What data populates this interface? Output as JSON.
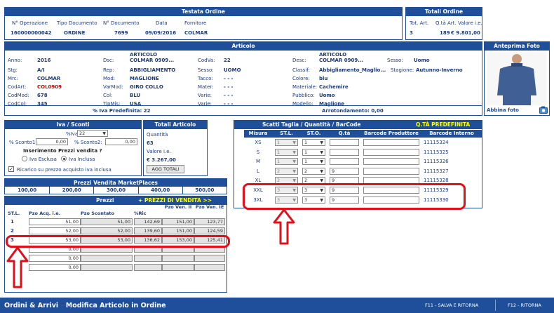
{
  "testata": {
    "title": "Testata Ordine",
    "labels": [
      "N° Operazione",
      "Tipo Documento",
      "N° Documento",
      "Data",
      "Fornitore"
    ],
    "values": [
      "160000000042",
      "ORDINE",
      "7699",
      "09/09/2016",
      "COLMAR"
    ]
  },
  "totali": {
    "title": "Totali Ordine",
    "labels": [
      "Tot. Art.",
      "Q.tà Art.",
      "Valore i.e."
    ],
    "values": [
      "3",
      "189",
      "€ 9.801,00"
    ]
  },
  "articolo": {
    "title": "Articolo",
    "col1": [
      [
        "Anno:",
        "2016"
      ],
      [
        "Stg:",
        "A/I"
      ],
      [
        "Mrc:",
        "COLMAR"
      ],
      [
        "CodArt:",
        "COL0909"
      ],
      [
        "CodMod:",
        "678"
      ],
      [
        "CodCol:",
        "345"
      ]
    ],
    "col2": [
      [
        "Dsc:",
        "ARTICOLO COLMAR 0909..."
      ],
      [
        "Rep:",
        "ABBIGLIAMENTO"
      ],
      [
        "Mod:",
        "MAGLIONE"
      ],
      [
        "VarMod:",
        "GIRO COLLO"
      ],
      [
        "Col:",
        "BLU"
      ],
      [
        "TipMis:",
        "USA"
      ]
    ],
    "col3": [
      [
        "CodVa:",
        "22"
      ],
      [
        "Sesso:",
        "UOMO"
      ],
      [
        "Tacco:",
        "- - -"
      ],
      [
        "Mater:",
        "- - -"
      ],
      [
        "Varie:",
        "- - -"
      ],
      [
        "Varie:",
        "- - -"
      ]
    ],
    "col4": [
      [
        "Desc:",
        "ARTICOLO COLMAR 0909..."
      ],
      [
        "Classif:",
        "Abbigliamento_Maglio..."
      ],
      [
        "Colore:",
        "blu"
      ],
      [
        "Materiale:",
        "Cachemire"
      ],
      [
        "Pubblico:",
        "Uomo"
      ],
      [
        "Modello:",
        "Maglione"
      ]
    ],
    "sesso_label": "Sesso:",
    "sesso_value": "Uomo",
    "stagione_label": "Stagione:",
    "stagione_value": "Autunno-Inverno",
    "iva_predefinita": "% Iva Predefinita: 22",
    "arrotondamento": "Arrotondamento: 0,00"
  },
  "anteprima": {
    "title": "Anteprima Foto",
    "abbina": "Abbina foto"
  },
  "iva": {
    "title": "Iva / Sconti",
    "iva_label": "%Iva:",
    "iva_value": "22",
    "sconto1_label": "% Sconto1:",
    "sconto1_value": "0,00",
    "sconto2_label": "% Sconto2:",
    "sconto2_value": "0,00",
    "inserimento": "Inserimento Prezzi vendita ?",
    "esclusa": "Iva Esclusa",
    "inclusa": "Iva Inclusa",
    "ricarico": "Ricarico su prezzo acquisto iva inclusa"
  },
  "totali_articolo": {
    "title": "Totali Articolo",
    "quantita_label": "Quantità",
    "quantita_value": "63",
    "valore_label": "Valore i.e.",
    "valore_value": "€ 3.267,00",
    "button": "AGG TOTALI"
  },
  "marketplaces": {
    "title": "Prezzi Vendita MarketPlaces",
    "values": [
      "100,00",
      "200,00",
      "300,00",
      "400,00",
      "500,00"
    ]
  },
  "prezzi": {
    "title": "Prezzi",
    "link": "+ PREZZI DI VENDITA >>",
    "headers": [
      "ST.L.",
      "Pzo Acq. i.e.",
      "Pzo Scontato",
      "%Ric",
      "Pzo Ven. II",
      "Pzo Ven. IE"
    ],
    "rows": [
      [
        "1",
        "51,00",
        "51,00",
        "142,69",
        "151,00",
        "123,77"
      ],
      [
        "2",
        "52,00",
        "52,00",
        "139,60",
        "151,00",
        "124,59"
      ],
      [
        "3",
        "53,00",
        "53,00",
        "136,62",
        "153,00",
        "125,41"
      ],
      [
        "",
        "0,00",
        "",
        "",
        "",
        ""
      ],
      [
        "",
        "0,00",
        "",
        "",
        "",
        ""
      ],
      [
        "",
        "0,00",
        "",
        "",
        "",
        ""
      ]
    ]
  },
  "scatti": {
    "title": "Scatti Taglia / Quantità / BarCode",
    "qta_predefinita": "Q.TÀ PREDEFINITA",
    "headers": [
      "Misura",
      "ST.L.",
      "ST.O.",
      "Q.tà",
      "Barcode Produttore",
      "Barcode Interno"
    ],
    "rows": [
      [
        "XS",
        "1",
        "1",
        "",
        "",
        "11115324"
      ],
      [
        "S",
        "1",
        "1",
        "",
        "",
        "11115325"
      ],
      [
        "M",
        "1",
        "1",
        "",
        "",
        "11115326"
      ],
      [
        "L",
        "2",
        "2",
        "9",
        "",
        "11115327"
      ],
      [
        "XL",
        "2",
        "2",
        "9",
        "",
        "11115328"
      ],
      [
        "XXL",
        "3",
        "3",
        "9",
        "",
        "11115329"
      ],
      [
        "3XL",
        "3",
        "3",
        "9",
        "",
        "11115330"
      ]
    ]
  },
  "footer": {
    "title_a": "Ordini & Arrivi",
    "dash": " - ",
    "title_b": "Modifica Articolo in Ordine",
    "f11": "F11 - SALVA E RITORNA",
    "f12": "F12 - RITORNA"
  },
  "colors": {
    "primary": "#1f4f9a",
    "highlight": "#e0101a",
    "yellow": "#ffff00"
  }
}
